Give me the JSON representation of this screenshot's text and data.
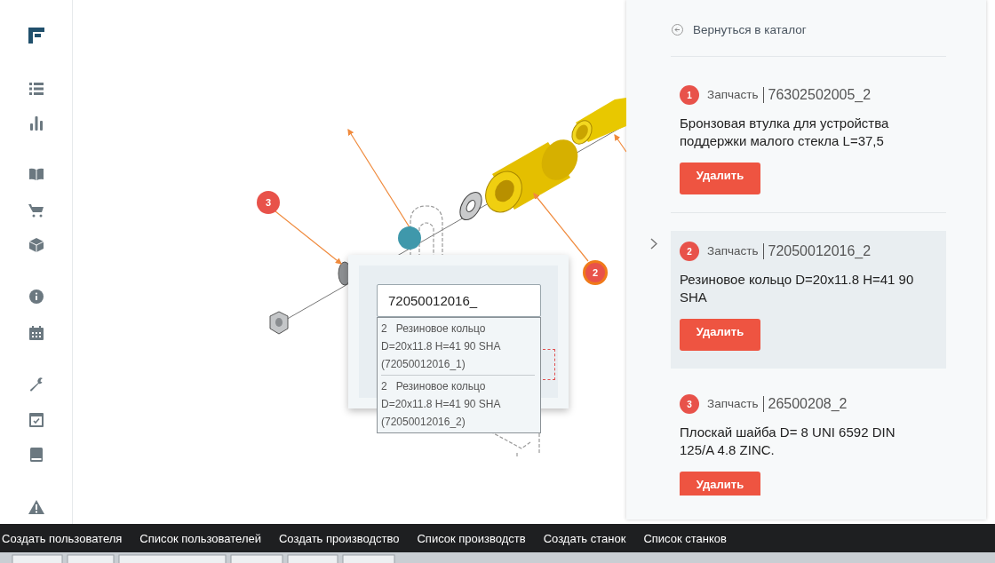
{
  "back_link": "Вернуться в каталог",
  "parts": [
    {
      "number": "1",
      "type": "Запчасть",
      "code": "76302502005_2",
      "description": "Бронзовая втулка для устройства поддержки малого стекла L=37,5",
      "button": "Удалить",
      "selected": false
    },
    {
      "number": "2",
      "type": "Запчасть",
      "code": "72050012016_2",
      "description": "Резиновое кольцо D=20x11.8 H=41 90 SHA",
      "button": "Удалить",
      "selected": true
    },
    {
      "number": "3",
      "type": "Запчасть",
      "code": "26500208_2",
      "description": "Плоскай шайба D= 8 UNI 6592 DIN 125/A 4.8 ZINC.",
      "button": "Удалить",
      "selected": false
    }
  ],
  "diagram": {
    "markers": [
      {
        "number": "3",
        "highlighted": false
      },
      {
        "number": "2",
        "highlighted": true
      }
    ],
    "search": {
      "value": "72050012016_",
      "suggestions": [
        {
          "text": "2   Резиновое кольцо D=20x11.8 H=41 90 SHA (72050012016_1)"
        },
        {
          "text": "2   Резиновое кольцо D=20x11.8 H=41 90 SHA (72050012016_2)"
        }
      ]
    }
  },
  "bottom_menu": [
    "Создать пользователя",
    "Список пользователей",
    "Создать производство",
    "Список производств",
    "Создать станок",
    "Список станков"
  ]
}
